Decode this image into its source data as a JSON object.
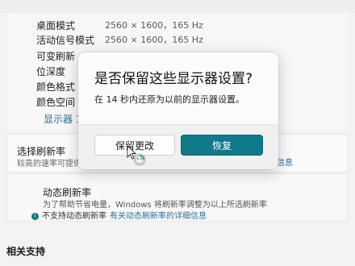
{
  "display_info": {
    "rows": [
      {
        "label": "桌面模式",
        "value": "2560 × 1600，165 Hz"
      },
      {
        "label": "活动信号模式",
        "value": "2560 × 1600，165 Hz"
      },
      {
        "label": "可变刷新",
        "value": ""
      },
      {
        "label": "位深度",
        "value": ""
      },
      {
        "label": "颜色格式",
        "value": ""
      },
      {
        "label": "颜色空间",
        "value": ""
      }
    ],
    "display_link": "显示器 1"
  },
  "refresh_rate": {
    "title": "选择刷新率",
    "description": "较高的速率可提供",
    "link_fragment": "信息"
  },
  "dynamic_refresh": {
    "title": "动态刷新率",
    "description": "为了帮助节省电量，Windows 将刷新率调整为以上所选刷新率",
    "status": "不支持动态刷新率",
    "link": "有关动态刷新率的详细信息"
  },
  "related_support": {
    "title": "相关支持"
  },
  "dialog": {
    "title": "是否保留这些显示器设置?",
    "message": "在 14 秒内还原为以前的显示器设置。",
    "keep_label": "保留更改",
    "revert_label": "恢复"
  },
  "colors": {
    "accent": "#0f7a8a",
    "link": "#2b6f9e"
  }
}
